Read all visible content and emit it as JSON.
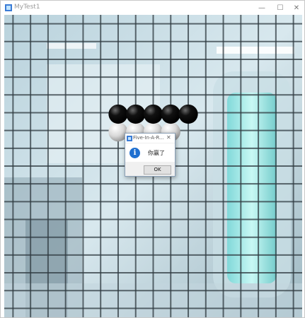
{
  "window": {
    "title": "MyTest1",
    "minimize_glyph": "—",
    "maximize_glyph": "☐",
    "close_glyph": "✕",
    "icon": "app-icon"
  },
  "board": {
    "grid_lines": 17,
    "line_color": "#2f3a40",
    "black_stones": [
      [
        6,
        5
      ],
      [
        7,
        5
      ],
      [
        8,
        5
      ],
      [
        9,
        5
      ],
      [
        10,
        5
      ]
    ],
    "white_stones": [
      [
        6,
        6
      ],
      [
        7,
        6
      ],
      [
        8,
        6
      ],
      [
        9,
        6
      ]
    ]
  },
  "dialog": {
    "title": "Five-In-A-R...",
    "close_glyph": "✕",
    "icon": "info-icon",
    "info_glyph": "i",
    "message": "你赢了",
    "ok_label": "OK",
    "accent_color": "#1e6fd0"
  }
}
